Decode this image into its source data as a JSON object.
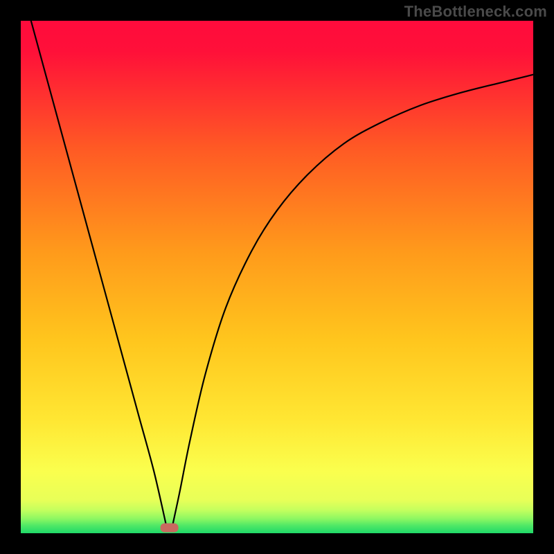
{
  "watermark": "TheBottleneck.com",
  "chart_data": {
    "type": "line",
    "title": "",
    "xlabel": "",
    "ylabel": "",
    "xlim": [
      0,
      100
    ],
    "ylim": [
      0,
      100
    ],
    "background_gradient": {
      "top": "#ff0b3c",
      "mid_upper": "#ff7a1f",
      "mid": "#ffd21e",
      "mid_lower": "#fff24a",
      "bottom": "#27e36a"
    },
    "marker": {
      "x": 29,
      "y": 1,
      "color": "#c86a5f",
      "shape": "rounded-rect"
    },
    "series": [
      {
        "name": "left-branch",
        "x": [
          2,
          5,
          8,
          11,
          14,
          17,
          20,
          23,
          26,
          28.5
        ],
        "y": [
          100,
          89,
          78,
          67,
          56,
          45,
          34,
          23,
          12,
          1
        ]
      },
      {
        "name": "right-branch",
        "x": [
          29.5,
          31,
          33,
          36,
          40,
          45,
          50,
          56,
          63,
          70,
          78,
          86,
          94,
          100
        ],
        "y": [
          1,
          8,
          18,
          31,
          44,
          55,
          63,
          70,
          76,
          80,
          83.5,
          86,
          88,
          89.5
        ]
      }
    ]
  }
}
